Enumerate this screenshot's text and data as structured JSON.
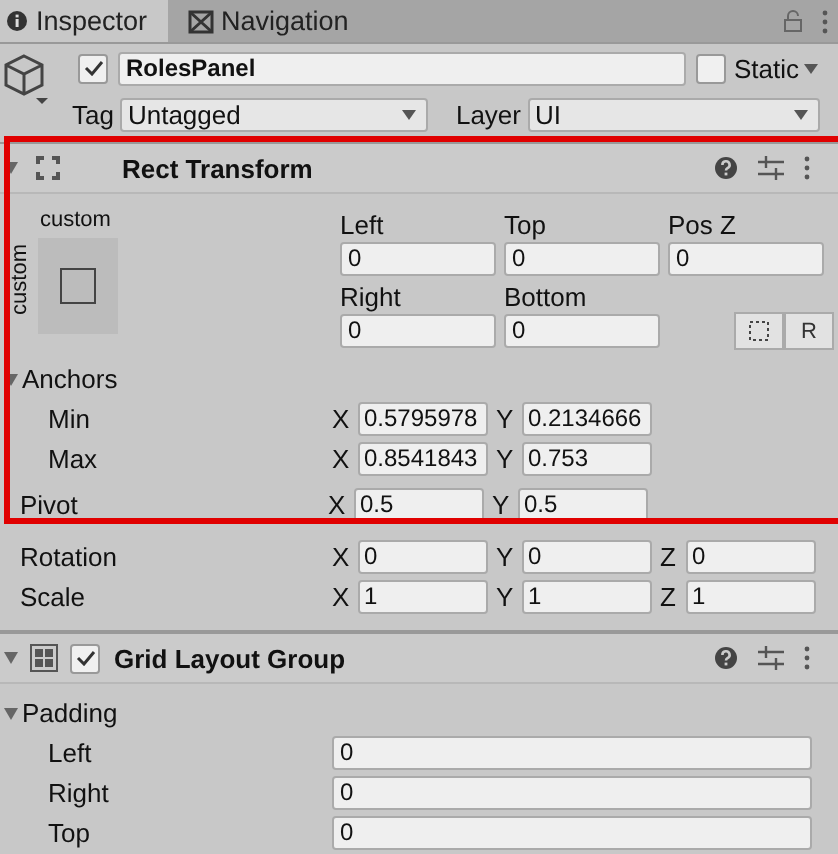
{
  "tabs": [
    {
      "label": "Inspector",
      "selected": true
    },
    {
      "label": "Navigation",
      "selected": false
    }
  ],
  "object": {
    "active": true,
    "name": "RolesPanel",
    "static": false,
    "static_label": "Static",
    "tag_label": "Tag",
    "tag": "Untagged",
    "layer_label": "Layer",
    "layer": "UI"
  },
  "rect_transform": {
    "title": "Rect Transform",
    "expanded": true,
    "highlighted": true,
    "preset_label": "custom",
    "preset_side_label": "custom",
    "position": [
      {
        "label": "Left",
        "value": "0"
      },
      {
        "label": "Top",
        "value": "0"
      },
      {
        "label": "Pos Z",
        "value": "0"
      },
      {
        "label": "Right",
        "value": "0"
      },
      {
        "label": "Bottom",
        "value": "0"
      }
    ],
    "buttons": [
      {
        "kind": "blueprint"
      },
      {
        "kind": "raw",
        "label": "R"
      }
    ],
    "anchors": {
      "label": "Anchors",
      "expanded": true,
      "rows": [
        {
          "label": "Min",
          "fields": [
            {
              "axis": "X",
              "value": "0.5795978"
            },
            {
              "axis": "Y",
              "value": "0.2134666"
            }
          ]
        },
        {
          "label": "Max",
          "fields": [
            {
              "axis": "X",
              "value": "0.8541843"
            },
            {
              "axis": "Y",
              "value": "0.753"
            }
          ]
        }
      ]
    },
    "vectors": [
      {
        "label": "Pivot",
        "fields": [
          {
            "axis": "X",
            "value": "0.5"
          },
          {
            "axis": "Y",
            "value": "0.5"
          }
        ]
      },
      {
        "label": "Rotation",
        "fields": [
          {
            "axis": "X",
            "value": "0"
          },
          {
            "axis": "Y",
            "value": "0"
          },
          {
            "axis": "Z",
            "value": "0"
          }
        ]
      },
      {
        "label": "Scale",
        "fields": [
          {
            "axis": "X",
            "value": "1"
          },
          {
            "axis": "Y",
            "value": "1"
          },
          {
            "axis": "Z",
            "value": "1"
          }
        ]
      }
    ]
  },
  "grid_layout": {
    "title": "Grid Layout Group",
    "enabled": true,
    "expanded": true,
    "padding": {
      "label": "Padding",
      "expanded": true,
      "rows": [
        {
          "label": "Left",
          "value": "0"
        },
        {
          "label": "Right",
          "value": "0"
        },
        {
          "label": "Top",
          "value": "0"
        }
      ]
    }
  }
}
